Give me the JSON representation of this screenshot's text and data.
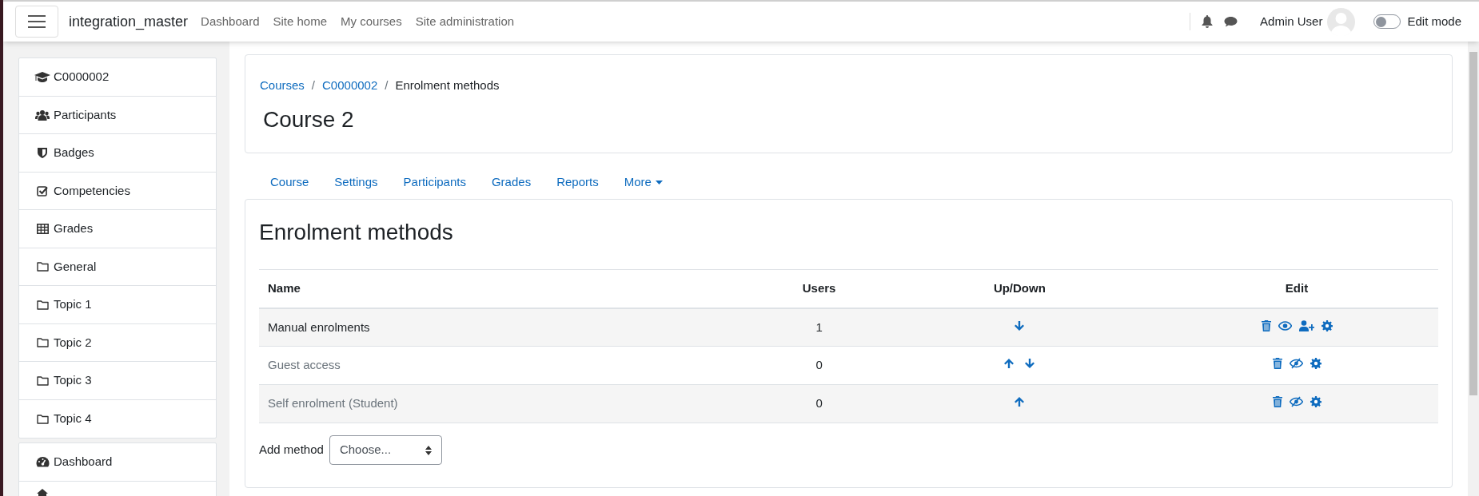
{
  "navbar": {
    "site_name": "integration_master",
    "links": [
      "Dashboard",
      "Site home",
      "My courses",
      "Site administration"
    ],
    "user_name": "Admin User",
    "edit_mode": {
      "label": "Edit mode",
      "on": false
    }
  },
  "sidebar": {
    "groups": [
      [
        {
          "label": "C0000002",
          "kind": "course"
        },
        {
          "label": "Participants",
          "kind": "participants"
        },
        {
          "label": "Badges",
          "kind": "badges"
        },
        {
          "label": "Competencies",
          "kind": "competencies"
        },
        {
          "label": "Grades",
          "kind": "grades"
        },
        {
          "label": "General",
          "kind": "section"
        },
        {
          "label": "Topic 1",
          "kind": "section"
        },
        {
          "label": "Topic 2",
          "kind": "section"
        },
        {
          "label": "Topic 3",
          "kind": "section"
        },
        {
          "label": "Topic 4",
          "kind": "section"
        }
      ],
      [
        {
          "label": "Dashboard",
          "kind": "dashboard"
        },
        {
          "kind": "home"
        }
      ]
    ]
  },
  "breadcrumb": {
    "items": [
      "Courses",
      "C0000002",
      "Enrolment methods"
    ],
    "separator": "/"
  },
  "course_title": "Course 2",
  "tabs": [
    {
      "label": "Course",
      "dropdown": false
    },
    {
      "label": "Settings",
      "dropdown": false
    },
    {
      "label": "Participants",
      "dropdown": false
    },
    {
      "label": "Grades",
      "dropdown": false
    },
    {
      "label": "Reports",
      "dropdown": false
    },
    {
      "label": "More",
      "dropdown": true
    }
  ],
  "page_title": "Enrolment methods",
  "table": {
    "columns": [
      "Name",
      "Users",
      "Up/Down",
      "Edit"
    ],
    "rows": [
      {
        "name": "Manual enrolments",
        "users": "1",
        "enabled": true,
        "can_move_up": false,
        "can_move_down": true,
        "can_enrol": true
      },
      {
        "name": "Guest access",
        "users": "0",
        "enabled": false,
        "can_move_up": true,
        "can_move_down": true,
        "can_enrol": false
      },
      {
        "name": "Self enrolment (Student)",
        "users": "0",
        "enabled": false,
        "can_move_up": true,
        "can_move_down": false,
        "can_enrol": false
      }
    ]
  },
  "add_method": {
    "label": "Add method",
    "value": "Choose..."
  }
}
